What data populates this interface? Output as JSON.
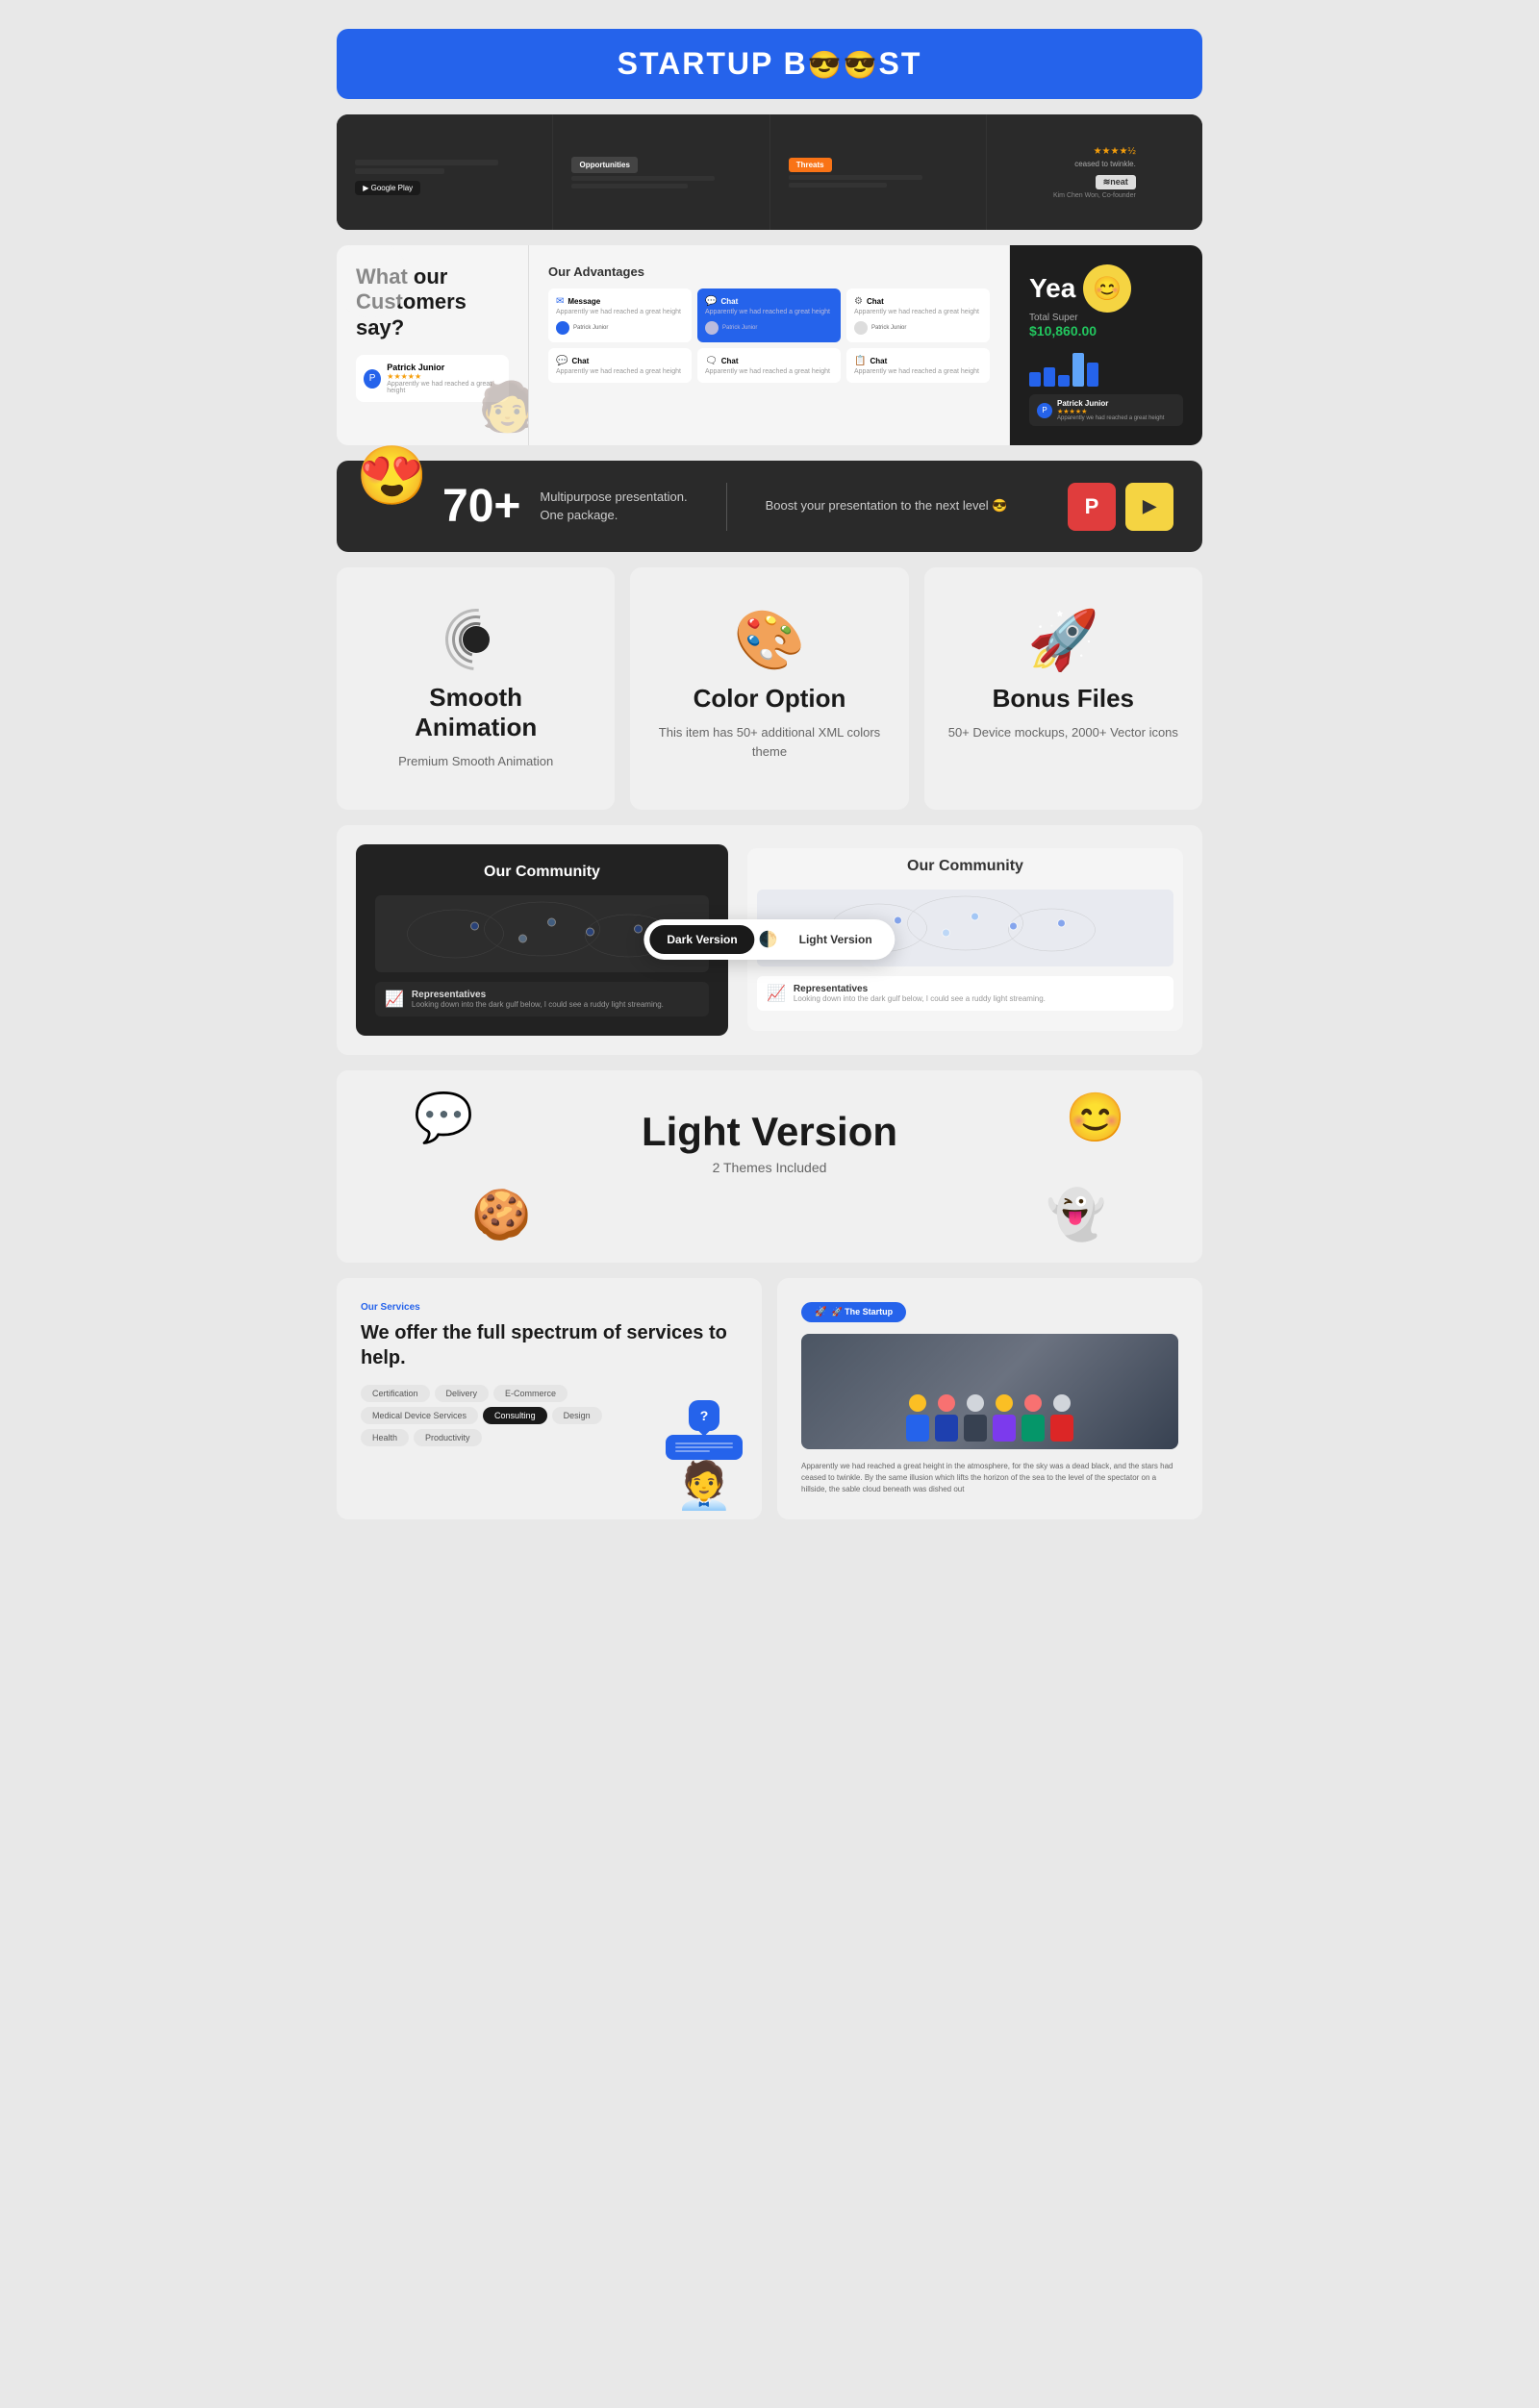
{
  "header": {
    "title": "STARTUP B",
    "emoji": "😎😎",
    "suffix": "ST"
  },
  "stats": {
    "number": "70+",
    "desc_line1": "Multipurpose presentation.",
    "desc_line2": "One package.",
    "boost_text": "Boost your presentation to the next level 😎"
  },
  "features": [
    {
      "id": "smooth-animation",
      "icon": "⬛",
      "title": "Smooth Animation",
      "desc": "Premium Smooth Animation"
    },
    {
      "id": "color-option",
      "icon": "🎨",
      "title": "Color Option",
      "desc": "This item has 50+ additional XML colors theme"
    },
    {
      "id": "bonus-files",
      "icon": "🚀",
      "title": "Bonus Files",
      "desc": "50+ Device mockups, 2000+ Vector icons"
    }
  ],
  "advantages": {
    "customers_say": "What our Customers say?",
    "our_advantages": "Our Advantages",
    "year_label": "Yea",
    "total_label": "Total Super",
    "amount": "$10,860.00",
    "patrick_name": "Patrick Junior",
    "patrick_text": "Apparently we had reached a great height"
  },
  "version_section": {
    "dark_title": "Our Community",
    "light_title": "Our Community",
    "dark_label": "Dark Version",
    "light_label": "Light Version",
    "reps_title": "Representatives",
    "reps_desc": "Looking down into the dark gulf below, I could see a ruddy light streaming."
  },
  "light_version": {
    "title": "Light Version",
    "subtitle": "2 Themes Included"
  },
  "services": {
    "label": "Our Services",
    "title": "We offer the full spectrum of services to help.",
    "tags": [
      "Certification",
      "Delivery",
      "E-Commerce",
      "Medical Device Services",
      "Consulting",
      "Design",
      "Health",
      "Productivity"
    ],
    "active_tag": "Consulting",
    "chatbot_question": "?",
    "chatbot_lines": "——————\n——————"
  },
  "startup": {
    "badge": "🚀 The Startup",
    "testimony": "Apparently we had reached a great height in the atmosphere, for the sky was a dead black, and the stars had ceased to twinkle. By the same illusion which lifts the horizon of the sea to the level of the spectator on a hillside, the sable cloud beneath was dished out"
  }
}
